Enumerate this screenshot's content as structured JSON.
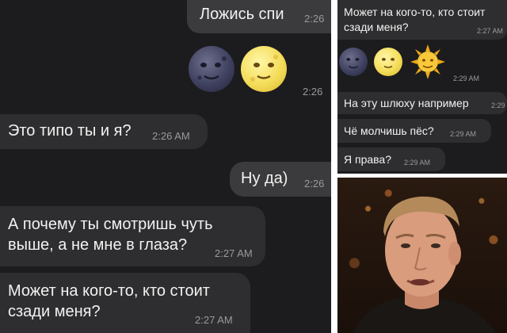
{
  "left_panel": {
    "messages": [
      {
        "dir": "out",
        "text": "Ложись спи",
        "time": "2:26"
      },
      {
        "dir": "out",
        "emoji": [
          "new-moon-face",
          "full-moon-face"
        ],
        "time": "2:26"
      },
      {
        "dir": "in",
        "text": "Это типо ты и я?",
        "time": "2:26 AM"
      },
      {
        "dir": "out",
        "text": "Ну да)",
        "time": "2:26"
      },
      {
        "dir": "in",
        "text": "А почему ты смотришь чуть\nвыше, а не мне в глаза?",
        "time": "2:27 AM"
      },
      {
        "dir": "in",
        "text": "Может на кого-то, кто стоит\nсзади меня?",
        "time": "2:27 AM"
      }
    ]
  },
  "right_panel": {
    "messages": [
      {
        "dir": "in",
        "text": "Может на кого-то, кто стоит\nсзади меня?",
        "time": "2:27 AM"
      },
      {
        "dir": "in",
        "emoji": [
          "new-moon-face",
          "full-moon-face",
          "sun-face"
        ],
        "time": "2:29 AM"
      },
      {
        "dir": "in",
        "text": "На эту шлюху например",
        "time": "2:29"
      },
      {
        "dir": "in",
        "text": "Чё молчишь пёс?",
        "time": "2:29 AM"
      },
      {
        "dir": "in",
        "text": "Я права?",
        "time": "2:29 AM"
      }
    ]
  },
  "photo": {
    "subject": "young man with short blond hair",
    "colors": {
      "background": "#1a120c",
      "skin": "#d79a7a",
      "hair": "#b48a5a"
    }
  },
  "colors": {
    "chat_background": "#1c1c1e",
    "incoming_bubble": "#2e2e30",
    "outgoing_bubble": "#3b3b3d",
    "timestamp": "#9a9a9e",
    "text": "#f2f2f2"
  }
}
